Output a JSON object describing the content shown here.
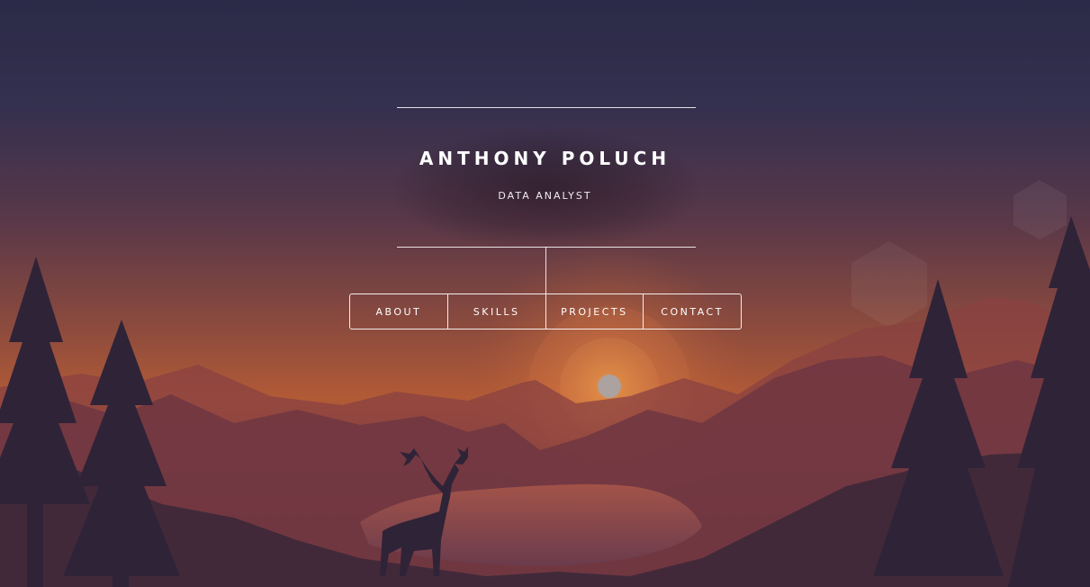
{
  "page": {
    "name": "ANTHONY POLUCH",
    "role": "DATA ANALYST"
  },
  "nav": {
    "items": [
      {
        "label": "ABOUT"
      },
      {
        "label": "SKILLS"
      },
      {
        "label": "PROJECTS"
      },
      {
        "label": "CONTACT"
      }
    ]
  },
  "colors": {
    "sky_top": "#2b2a47",
    "sky_mid": "#6d3d47",
    "horizon": "#c8673a",
    "foreground": "#2f2337",
    "text": "#ffffff"
  }
}
